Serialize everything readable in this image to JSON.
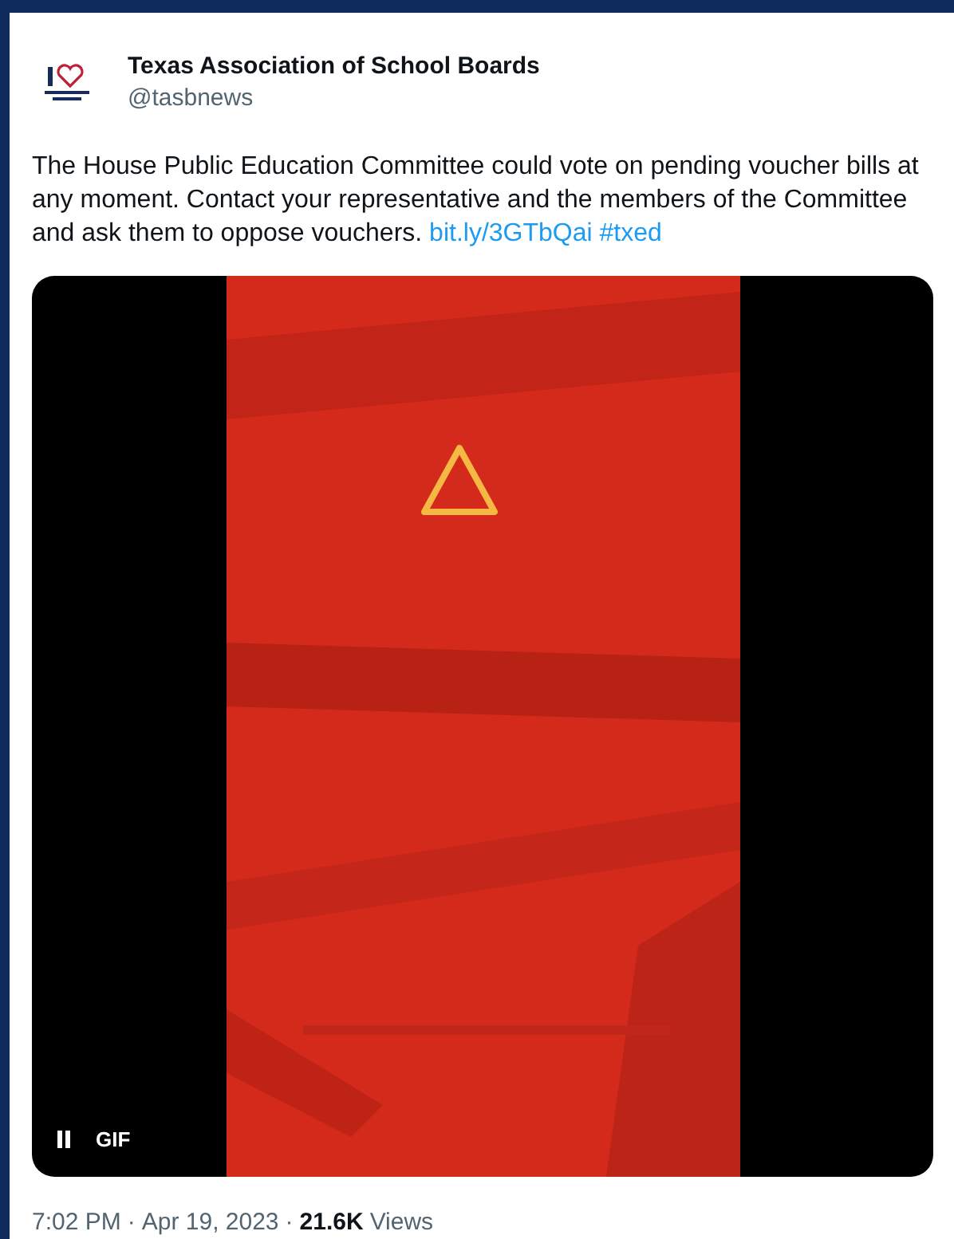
{
  "author": {
    "name": "Texas Association of School Boards",
    "handle": "@tasbnews"
  },
  "post": {
    "parts": [
      {
        "kind": "text",
        "text": "The House Public Education Committee could vote on pending voucher bills at any moment. Contact your representative and the members of the Committee and ask them to oppose vouchers."
      },
      {
        "kind": "link",
        "text": "bit.ly/3GTbQai"
      },
      {
        "kind": "link",
        "text": "#txed"
      }
    ]
  },
  "media": {
    "kind": "gif",
    "badge": "GIF",
    "playing": true
  },
  "footer": {
    "time": "7:02 PM",
    "separator": "·",
    "date": "Apr 19, 2023",
    "views_count": "21.6K",
    "views_label": "Views"
  }
}
